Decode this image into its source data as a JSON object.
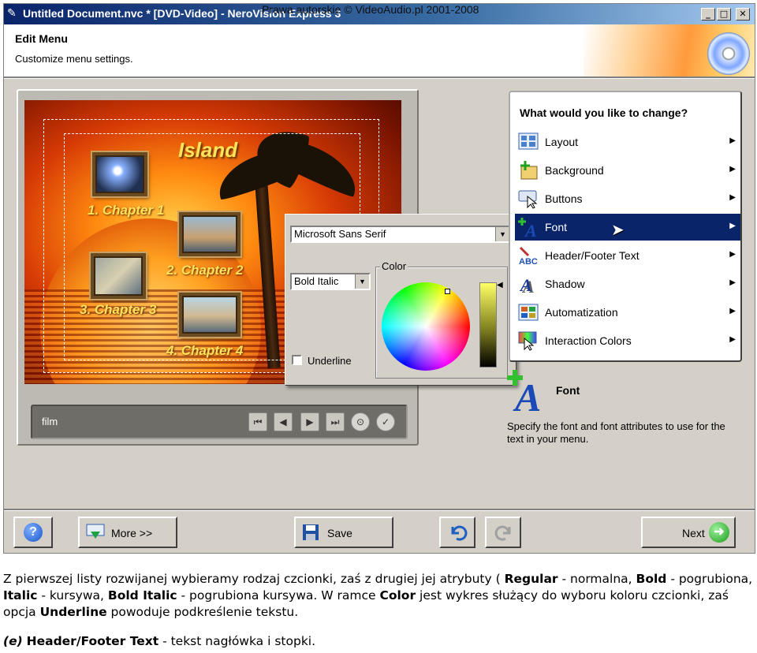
{
  "watermark": "Prawa autorskie © VideoAudio.pl 2001-2008",
  "window": {
    "title": "Untitled Document.nvc * [DVD-Video] - NeroVision Express 3",
    "controls": {
      "minimize": "_",
      "maximize": "□",
      "close": "✕"
    }
  },
  "header": {
    "title": "Edit Menu",
    "subtitle": "Customize menu settings."
  },
  "preview": {
    "menu_title": "Island",
    "chapters": [
      "1. Chapter 1",
      "2. Chapter 2",
      "3. Chapter 3",
      "4. Chapter 4"
    ],
    "footer_label": "film"
  },
  "font_popup": {
    "font_family": "Microsoft Sans Serif",
    "font_style": "Bold Italic",
    "color_group_label": "Color",
    "underline_label": "Underline",
    "underline_checked": false
  },
  "options": {
    "question": "What would you like to change?",
    "items": [
      {
        "label": "Layout",
        "icon": "layout-icon"
      },
      {
        "label": "Background",
        "icon": "background-icon"
      },
      {
        "label": "Buttons",
        "icon": "buttons-icon"
      },
      {
        "label": "Font",
        "icon": "font-icon"
      },
      {
        "label": "Header/Footer Text",
        "icon": "header-footer-icon"
      },
      {
        "label": "Shadow",
        "icon": "shadow-icon"
      },
      {
        "label": "Automatization",
        "icon": "automatization-icon"
      },
      {
        "label": "Interaction Colors",
        "icon": "interaction-colors-icon"
      }
    ],
    "selected": "Font"
  },
  "info": {
    "title": "Font",
    "description": "Specify the font and font attributes to use for the text in your menu."
  },
  "buttons": {
    "help": "?",
    "more": "More >>",
    "save": "Save",
    "next": "Next"
  },
  "caption": {
    "p1": "Z pierwszej listy rozwijanej wybieramy rodzaj czcionki, zaś z drugiej jej atrybuty ( ",
    "regular": "Regular",
    "p2": " - normalna, ",
    "bold": "Bold",
    "p3": " - pogrubiona, ",
    "italic": "Italic",
    "p4": " - kursywa, ",
    "bold_italic": "Bold Italic",
    "p5": " - pogrubiona kursywa. W ramce ",
    "color": "Color",
    "p6": " jest wykres służący do wyboru koloru czcionki, zaś opcja ",
    "underline": "Underline",
    "p7": " powoduje podkreślenie tekstu.",
    "section_label": "(e)",
    "section_title": "Header/Footer Text",
    "section_desc": " - tekst nagłówka i stopki."
  },
  "colors": {
    "selection": "#0a246a",
    "title_bar": "#0a246a",
    "menu_text": "#ffe35a"
  }
}
